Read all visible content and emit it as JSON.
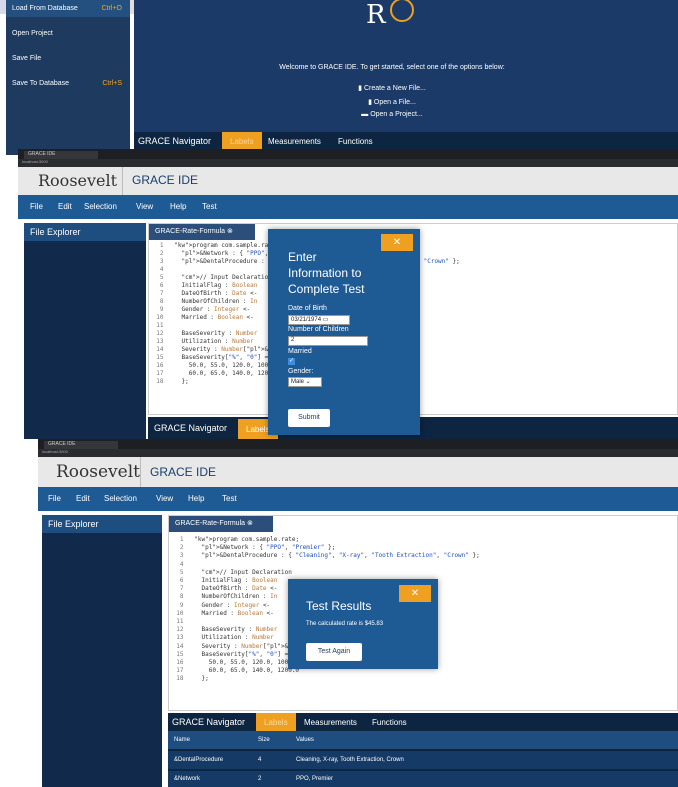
{
  "shot1": {
    "menu_items": [
      {
        "label": "Load From Database",
        "shortcut": "Ctrl+O"
      },
      {
        "label": "Open Project",
        "shortcut": ""
      },
      {
        "label": "Save File",
        "shortcut": ""
      },
      {
        "label": "Save To Database",
        "shortcut": "Ctrl+S"
      }
    ],
    "logo_text": "R",
    "welcome": "Welcome to GRACE IDE. To get started, select one of the options below:",
    "links": [
      "Create a New File...",
      "Open a File...",
      "Open a Project..."
    ],
    "nav": {
      "title": "GRACE Navigator",
      "tabs": [
        "Labels",
        "Measurements",
        "Functions"
      ]
    }
  },
  "browser": {
    "tab_label": "GRACE IDE",
    "url": "localhost:3000"
  },
  "app": {
    "brand": "Roosevelt",
    "title": "GRACE IDE",
    "menu": [
      "File",
      "Edit",
      "Selection",
      "View",
      "Help",
      "Test"
    ],
    "explorer_title": "File Explorer",
    "editor_tab": "GRACE-Rate-Formula",
    "code_lines": [
      {
        "n": "1",
        "t": "program com.sample.rate;"
      },
      {
        "n": "2",
        "t": "  &Network : { \"PPO\", \"Premier\" };"
      },
      {
        "n": "3",
        "t": "  &DentalProcedure : { \"Cleaning\", \"X-ray\", \"Tooth Extraction\", \"Crown\" };"
      },
      {
        "n": "4",
        "t": ""
      },
      {
        "n": "5",
        "t": "  // Input Declaration"
      },
      {
        "n": "6",
        "t": "  InitialFlag : Boolean"
      },
      {
        "n": "7",
        "t": "  DateOfBirth : Date <- "
      },
      {
        "n": "8",
        "t": "  NumberOfChildren : In"
      },
      {
        "n": "9",
        "t": "  Gender : Integer <- "
      },
      {
        "n": "10",
        "t": "  Married : Boolean <- "
      },
      {
        "n": "11",
        "t": ""
      },
      {
        "n": "12",
        "t": "  BaseSeverity : Number"
      },
      {
        "n": "13",
        "t": "  Utilization : Number"
      },
      {
        "n": "14",
        "t": "  Severity : Number[&N"
      },
      {
        "n": "15",
        "t": "  BaseSeverity[\"%\", \"0\"] = {"
      },
      {
        "n": "16",
        "t": "    50.0, 55.0, 120.0, 1000.0,"
      },
      {
        "n": "17",
        "t": "    60.0, 65.0, 140.0, 1200.0"
      },
      {
        "n": "18",
        "t": "  };"
      }
    ]
  },
  "shot2": {
    "modal": {
      "close_label": "✕",
      "title_lines": [
        "Enter",
        "Information to",
        "Complete Test"
      ],
      "dob_label": "Date of Birth",
      "dob_value": "03/21/1974",
      "children_label": "Number of Children",
      "children_value": "2",
      "married_label": "Married",
      "married_checked": true,
      "gender_label": "Gender:",
      "gender_value": "Male",
      "submit_label": "Submit"
    },
    "nav": {
      "title": "GRACE Navigator",
      "tab": "Labels"
    }
  },
  "shot3": {
    "modal": {
      "close_label": "✕",
      "title": "Test Results",
      "result": "The calculated rate is $45.83",
      "again_label": "Test Again"
    },
    "nav": {
      "title": "GRACE Navigator",
      "tabs": [
        "Labels",
        "Measurements",
        "Functions"
      ]
    },
    "table": {
      "headers": [
        "Name",
        "Size",
        "Values"
      ],
      "rows": [
        [
          "&DentalProcedure",
          "4",
          "Cleaning, X-ray, Tooth Extraction, Crown"
        ],
        [
          "&Network",
          "2",
          "PPO, Premier"
        ]
      ]
    }
  },
  "colors": {
    "accent": "#f0a020",
    "primary": "#1e5a93",
    "dark": "#11294a"
  }
}
